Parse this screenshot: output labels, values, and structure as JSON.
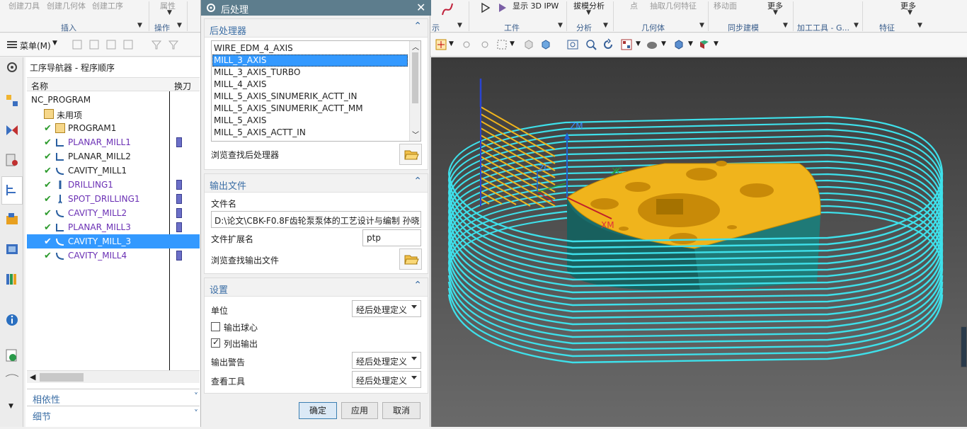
{
  "ribbon": {
    "top_labels": [
      "创建刀具",
      "创建几何体",
      "创建工序",
      "属性",
      "显示 3D IPW",
      "拔模分析",
      "点",
      "抽取几何特征",
      "移动面",
      "更多",
      "更多"
    ],
    "groups": [
      "插入",
      "操作",
      "示",
      "工件",
      "分析",
      "几何体",
      "同步建模",
      "加工工具 - G...",
      "特征"
    ]
  },
  "toolbar2": {
    "menu_label": "菜单(M)"
  },
  "navigator": {
    "title": "工序导航器 - 程序顺序",
    "col_name": "名称",
    "col_tool": "换刀",
    "root": "NC_PROGRAM",
    "unused": "未用项",
    "rows": [
      {
        "label": "PROGRAM1",
        "purple": false,
        "tool": false
      },
      {
        "label": "PLANAR_MILL1",
        "purple": true,
        "tool": true
      },
      {
        "label": "PLANAR_MILL2",
        "purple": false,
        "tool": false
      },
      {
        "label": "CAVITY_MILL1",
        "purple": false,
        "tool": false
      },
      {
        "label": "DRILLING1",
        "purple": true,
        "tool": true
      },
      {
        "label": "SPOT_DRILLING1",
        "purple": true,
        "tool": true
      },
      {
        "label": "CAVITY_MILL2",
        "purple": true,
        "tool": true
      },
      {
        "label": "PLANAR_MILL3",
        "purple": true,
        "tool": true
      },
      {
        "label": "CAVITY_MILL_3",
        "purple": false,
        "tool": false,
        "selected": true
      },
      {
        "label": "CAVITY_MILL4",
        "purple": true,
        "tool": true
      }
    ],
    "bottom_dependency": "相依性",
    "bottom_detail": "细节"
  },
  "dialog": {
    "title": "后处理",
    "sec_postprocessor": "后处理器",
    "postprocessors": [
      "WIRE_EDM_4_AXIS",
      "MILL_3_AXIS",
      "MILL_3_AXIS_TURBO",
      "MILL_4_AXIS",
      "MILL_5_AXIS_SINUMERIK_ACTT_IN",
      "MILL_5_AXIS_SINUMERIK_ACTT_MM",
      "MILL_5_AXIS",
      "MILL_5_AXIS_ACTT_IN"
    ],
    "browse_post": "浏览查找后处理器",
    "sec_output": "输出文件",
    "file_name_label": "文件名",
    "file_name_value": "D:\\论文\\CBK-F0.8F齿轮泵泵体的工艺设计与编制 孙晓",
    "ext_label": "文件扩展名",
    "ext_value": "ptp",
    "browse_output": "浏览查找输出文件",
    "sec_settings": "设置",
    "unit_label": "单位",
    "unit_value": "经后处理定义",
    "ball_center": "输出球心",
    "list_output": "列出输出",
    "warn_label": "输出警告",
    "warn_value": "经后处理定义",
    "tool_label": "查看工具",
    "tool_value": "经后处理定义",
    "ok": "确定",
    "apply": "应用",
    "cancel": "取消"
  },
  "viewport": {
    "axis_zm": "ZM",
    "axis_xm": "XM",
    "axis_zc": "ZC",
    "axis_yc": "YC"
  }
}
